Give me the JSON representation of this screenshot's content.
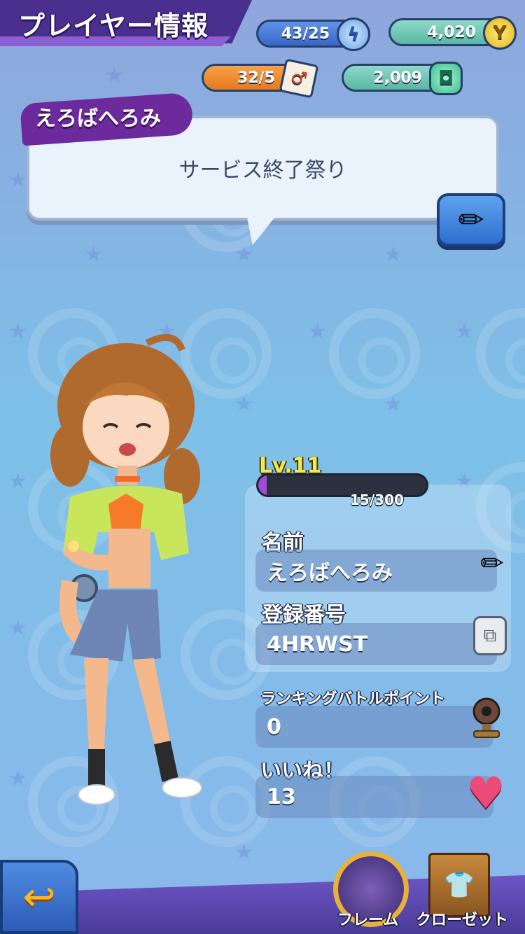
{
  "header": {
    "title": "プレイヤー情報",
    "stamina": "43/25",
    "coins": "4,020",
    "tickets": "32/5",
    "gems": "2,009"
  },
  "profile_card": {
    "player_name_tag": "えろばへろみ",
    "message": "サービス終了祭り"
  },
  "level": {
    "label": "Lv.11",
    "exp_text": "15/300",
    "exp_fraction": 0.05
  },
  "fields": {
    "name_label": "名前",
    "name_value": "えろばへろみ",
    "id_label": "登録番号",
    "id_value": "4HRWST",
    "ranking_label": "ランキングバトルポイント",
    "ranking_value": "0",
    "likes_label": "いいね！",
    "likes_value": "13"
  },
  "bottom": {
    "frame_label": "フレーム",
    "closet_label": "クローゼット"
  },
  "icons": {
    "stamina": "lightning-icon",
    "coins": "y-coin-icon",
    "tickets": "ticket-icon",
    "gems": "gem-icon",
    "edit": "pencil-icon",
    "copy": "copy-icon",
    "ranking": "webcam-trophy-icon",
    "likes": "heart-icon",
    "back": "back-arrow-icon"
  },
  "colors": {
    "level_text": "#f5e84a",
    "exp_fill": "#a24ad6",
    "tag_purple": "#6d2a9c"
  }
}
